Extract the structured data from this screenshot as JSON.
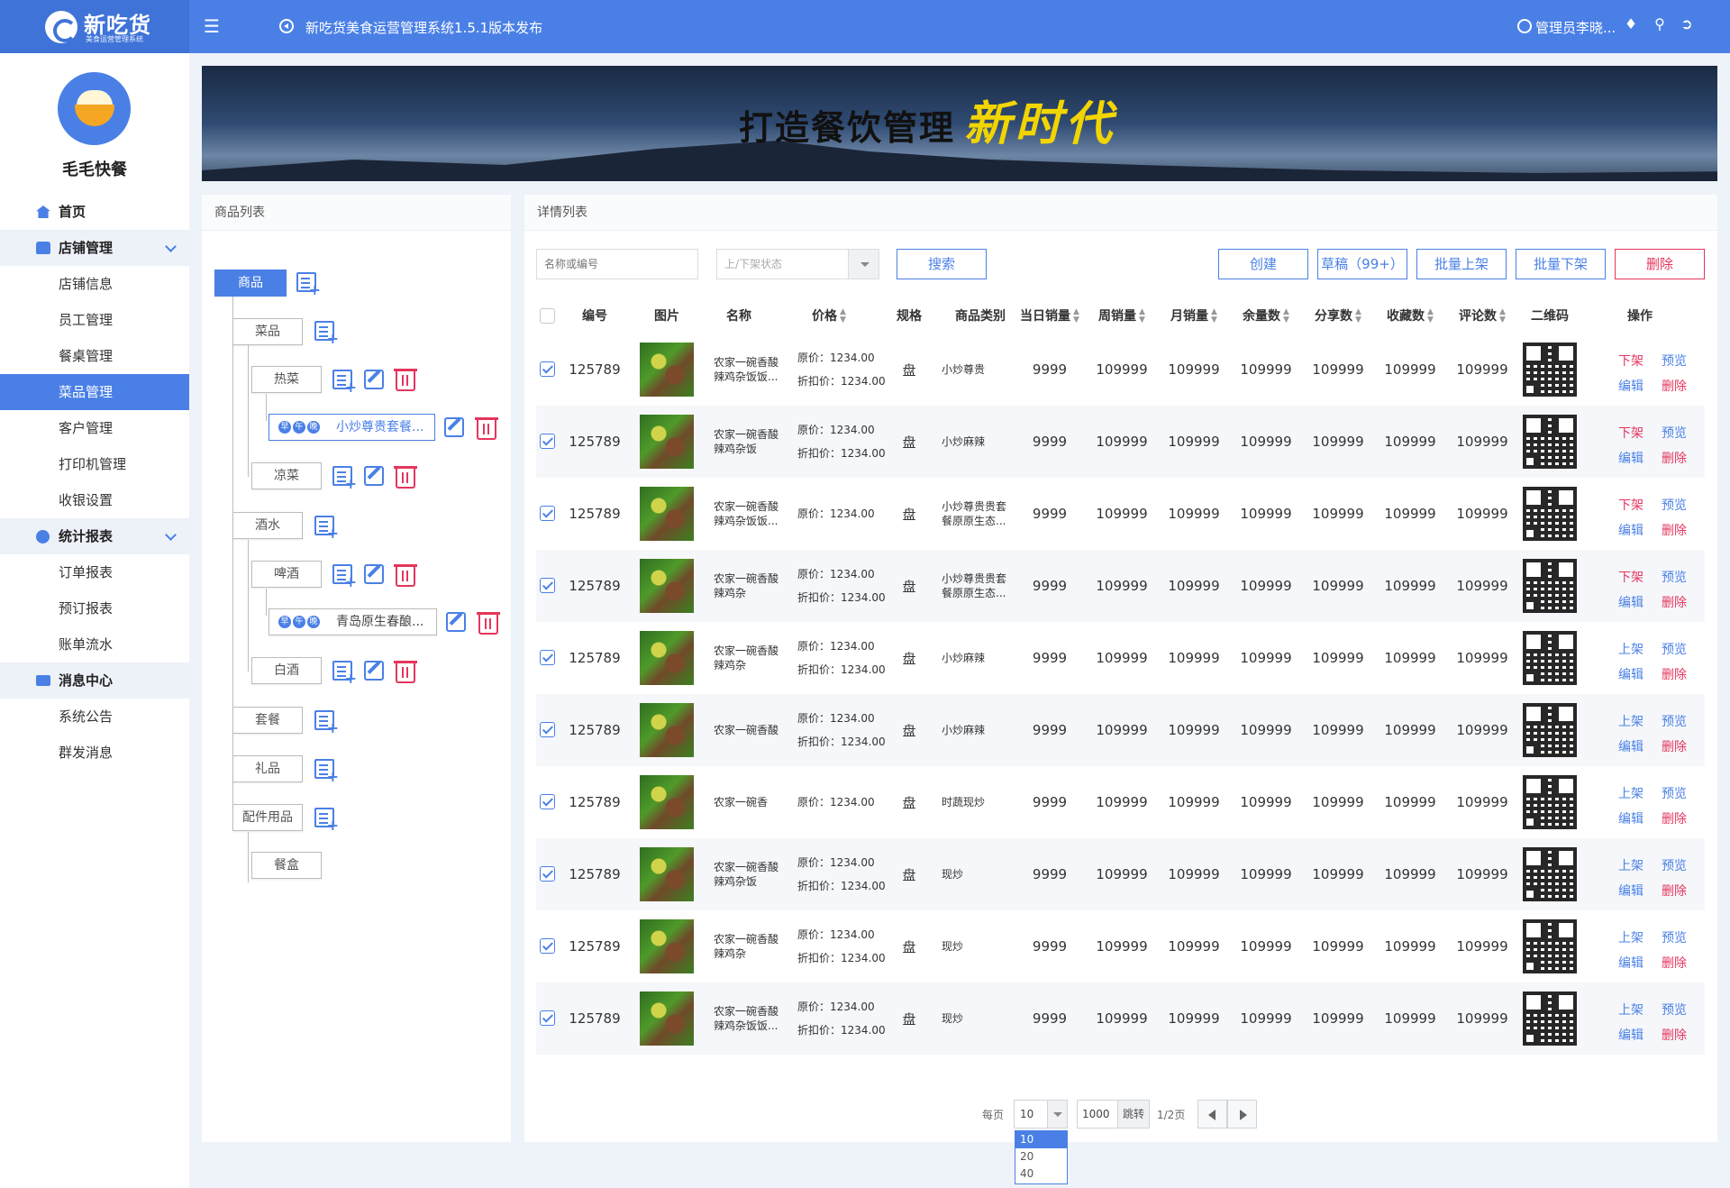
{
  "app": {
    "logo_title": "新吃货",
    "logo_subtitle": "美食运营管理系统",
    "notice": "新吃货美食运营管理系统1.5.1版本发布",
    "user": "管理员李晓..."
  },
  "sidebar": {
    "shop_name": "毛毛快餐",
    "items": [
      {
        "label": "首页",
        "type": "group",
        "icon": "home-icon"
      },
      {
        "label": "店铺管理",
        "type": "group",
        "icon": "shop-icon",
        "expandable": true
      },
      {
        "label": "店铺信息",
        "type": "item"
      },
      {
        "label": "员工管理",
        "type": "item"
      },
      {
        "label": "餐桌管理",
        "type": "item"
      },
      {
        "label": "菜品管理",
        "type": "item",
        "active": true
      },
      {
        "label": "客户管理",
        "type": "item"
      },
      {
        "label": "打印机管理",
        "type": "item"
      },
      {
        "label": "收银设置",
        "type": "item"
      },
      {
        "label": "统计报表",
        "type": "group",
        "icon": "stats-icon",
        "expandable": true
      },
      {
        "label": "订单报表",
        "type": "item"
      },
      {
        "label": "预订报表",
        "type": "item"
      },
      {
        "label": "账单流水",
        "type": "item"
      },
      {
        "label": "消息中心",
        "type": "group",
        "icon": "mail-icon"
      },
      {
        "label": "系统公告",
        "type": "item"
      },
      {
        "label": "群发消息",
        "type": "item"
      }
    ]
  },
  "banner": {
    "text_main": "打造餐饮管理",
    "text_accent": "新时代"
  },
  "left_panel": {
    "title": "商品列表",
    "tree": {
      "root": "商品",
      "cat_dishes": "菜品",
      "hot_dishes": "热菜",
      "hot_item": "小炒尊贵套餐...",
      "cold_dishes": "凉菜",
      "drinks": "酒水",
      "beer": "啤酒",
      "beer_item": "青岛原生春酿...",
      "baijiu": "白酒",
      "set_meal": "套餐",
      "gifts": "礼品",
      "accessories": "配件用品",
      "box": "餐盒",
      "meal_tags": [
        "早",
        "午",
        "晚"
      ]
    }
  },
  "right_panel": {
    "title": "详情列表",
    "search_placeholder": "名称或编号",
    "status_placeholder": "上/下架状态",
    "search_btn": "搜索",
    "actions": {
      "create": "创建",
      "draft": "草稿（99+）",
      "batch_on": "批量上架",
      "batch_off": "批量下架",
      "delete": "删除"
    },
    "columns": {
      "id": "编号",
      "img": "图片",
      "name": "名称",
      "price": "价格",
      "spec": "规格",
      "category": "商品类别",
      "daily": "当日销量",
      "weekly": "周销量",
      "monthly": "月销量",
      "stock": "余量数",
      "shares": "分享数",
      "favorites": "收藏数",
      "comments": "评论数",
      "qr": "二维码",
      "ops": "操作"
    },
    "price_labels": {
      "original": "原价：",
      "discount": "折扣价："
    },
    "rows": [
      {
        "id": "125789",
        "name": "农家一碗香酸辣鸡杂饭饭...",
        "original": "1234.00",
        "discount": "1234.00",
        "spec": "盘",
        "category": "小炒尊贵",
        "daily": "9999",
        "weekly": "109999",
        "monthly": "109999",
        "stock": "109999",
        "shares": "109999",
        "favorites": "109999",
        "comments": "109999",
        "op1": "下架",
        "op2": "预览",
        "op3": "编辑",
        "op4": "删除"
      },
      {
        "id": "125789",
        "name": "农家一碗香酸辣鸡杂饭",
        "original": "1234.00",
        "discount": "1234.00",
        "spec": "盘",
        "category": "小炒麻辣",
        "daily": "9999",
        "weekly": "109999",
        "monthly": "109999",
        "stock": "109999",
        "shares": "109999",
        "favorites": "109999",
        "comments": "109999",
        "op1": "下架",
        "op2": "预览",
        "op3": "编辑",
        "op4": "删除"
      },
      {
        "id": "125789",
        "name": "农家一碗香酸辣鸡杂饭饭...",
        "original": "1234.00",
        "discount": "",
        "spec": "盘",
        "category": "小炒尊贵贵套餐原原生态...",
        "daily": "9999",
        "weekly": "109999",
        "monthly": "109999",
        "stock": "109999",
        "shares": "109999",
        "favorites": "109999",
        "comments": "109999",
        "op1": "下架",
        "op2": "预览",
        "op3": "编辑",
        "op4": "删除"
      },
      {
        "id": "125789",
        "name": "农家一碗香酸辣鸡杂",
        "original": "1234.00",
        "discount": "1234.00",
        "spec": "盘",
        "category": "小炒尊贵贵套餐原原生态...",
        "daily": "9999",
        "weekly": "109999",
        "monthly": "109999",
        "stock": "109999",
        "shares": "109999",
        "favorites": "109999",
        "comments": "109999",
        "op1": "下架",
        "op2": "预览",
        "op3": "编辑",
        "op4": "删除"
      },
      {
        "id": "125789",
        "name": "农家一碗香酸辣鸡杂",
        "original": "1234.00",
        "discount": "1234.00",
        "spec": "盘",
        "category": "小炒麻辣",
        "daily": "9999",
        "weekly": "109999",
        "monthly": "109999",
        "stock": "109999",
        "shares": "109999",
        "favorites": "109999",
        "comments": "109999",
        "op1": "上架",
        "op2": "预览",
        "op3": "编辑",
        "op4": "删除"
      },
      {
        "id": "125789",
        "name": "农家一碗香酸",
        "original": "1234.00",
        "discount": "1234.00",
        "spec": "盘",
        "category": "小炒麻辣",
        "daily": "9999",
        "weekly": "109999",
        "monthly": "109999",
        "stock": "109999",
        "shares": "109999",
        "favorites": "109999",
        "comments": "109999",
        "op1": "上架",
        "op2": "预览",
        "op3": "编辑",
        "op4": "删除"
      },
      {
        "id": "125789",
        "name": "农家一碗香",
        "original": "1234.00",
        "discount": "",
        "spec": "盘",
        "category": "时蔬现炒",
        "daily": "9999",
        "weekly": "109999",
        "monthly": "109999",
        "stock": "109999",
        "shares": "109999",
        "favorites": "109999",
        "comments": "109999",
        "op1": "上架",
        "op2": "预览",
        "op3": "编辑",
        "op4": "删除"
      },
      {
        "id": "125789",
        "name": "农家一碗香酸辣鸡杂饭",
        "original": "1234.00",
        "discount": "1234.00",
        "spec": "盘",
        "category": "现炒",
        "daily": "9999",
        "weekly": "109999",
        "monthly": "109999",
        "stock": "109999",
        "shares": "109999",
        "favorites": "109999",
        "comments": "109999",
        "op1": "上架",
        "op2": "预览",
        "op3": "编辑",
        "op4": "删除"
      },
      {
        "id": "125789",
        "name": "农家一碗香酸辣鸡杂",
        "original": "1234.00",
        "discount": "1234.00",
        "spec": "盘",
        "category": "现炒",
        "daily": "9999",
        "weekly": "109999",
        "monthly": "109999",
        "stock": "109999",
        "shares": "109999",
        "favorites": "109999",
        "comments": "109999",
        "op1": "上架",
        "op2": "预览",
        "op3": "编辑",
        "op4": "删除"
      },
      {
        "id": "125789",
        "name": "农家一碗香酸辣鸡杂饭饭...",
        "original": "1234.00",
        "discount": "1234.00",
        "spec": "盘",
        "category": "现炒",
        "daily": "9999",
        "weekly": "109999",
        "monthly": "109999",
        "stock": "109999",
        "shares": "109999",
        "favorites": "109999",
        "comments": "109999",
        "op1": "上架",
        "op2": "预览",
        "op3": "编辑",
        "op4": "删除"
      }
    ],
    "pagination": {
      "per_page_label": "每页",
      "per_page": "10",
      "options": [
        "10",
        "20",
        "40"
      ],
      "total_input": "1000",
      "jump": "跳转",
      "count": "1/2页"
    }
  },
  "colors": {
    "accent": "#4a80e6",
    "danger": "#e5355d"
  }
}
